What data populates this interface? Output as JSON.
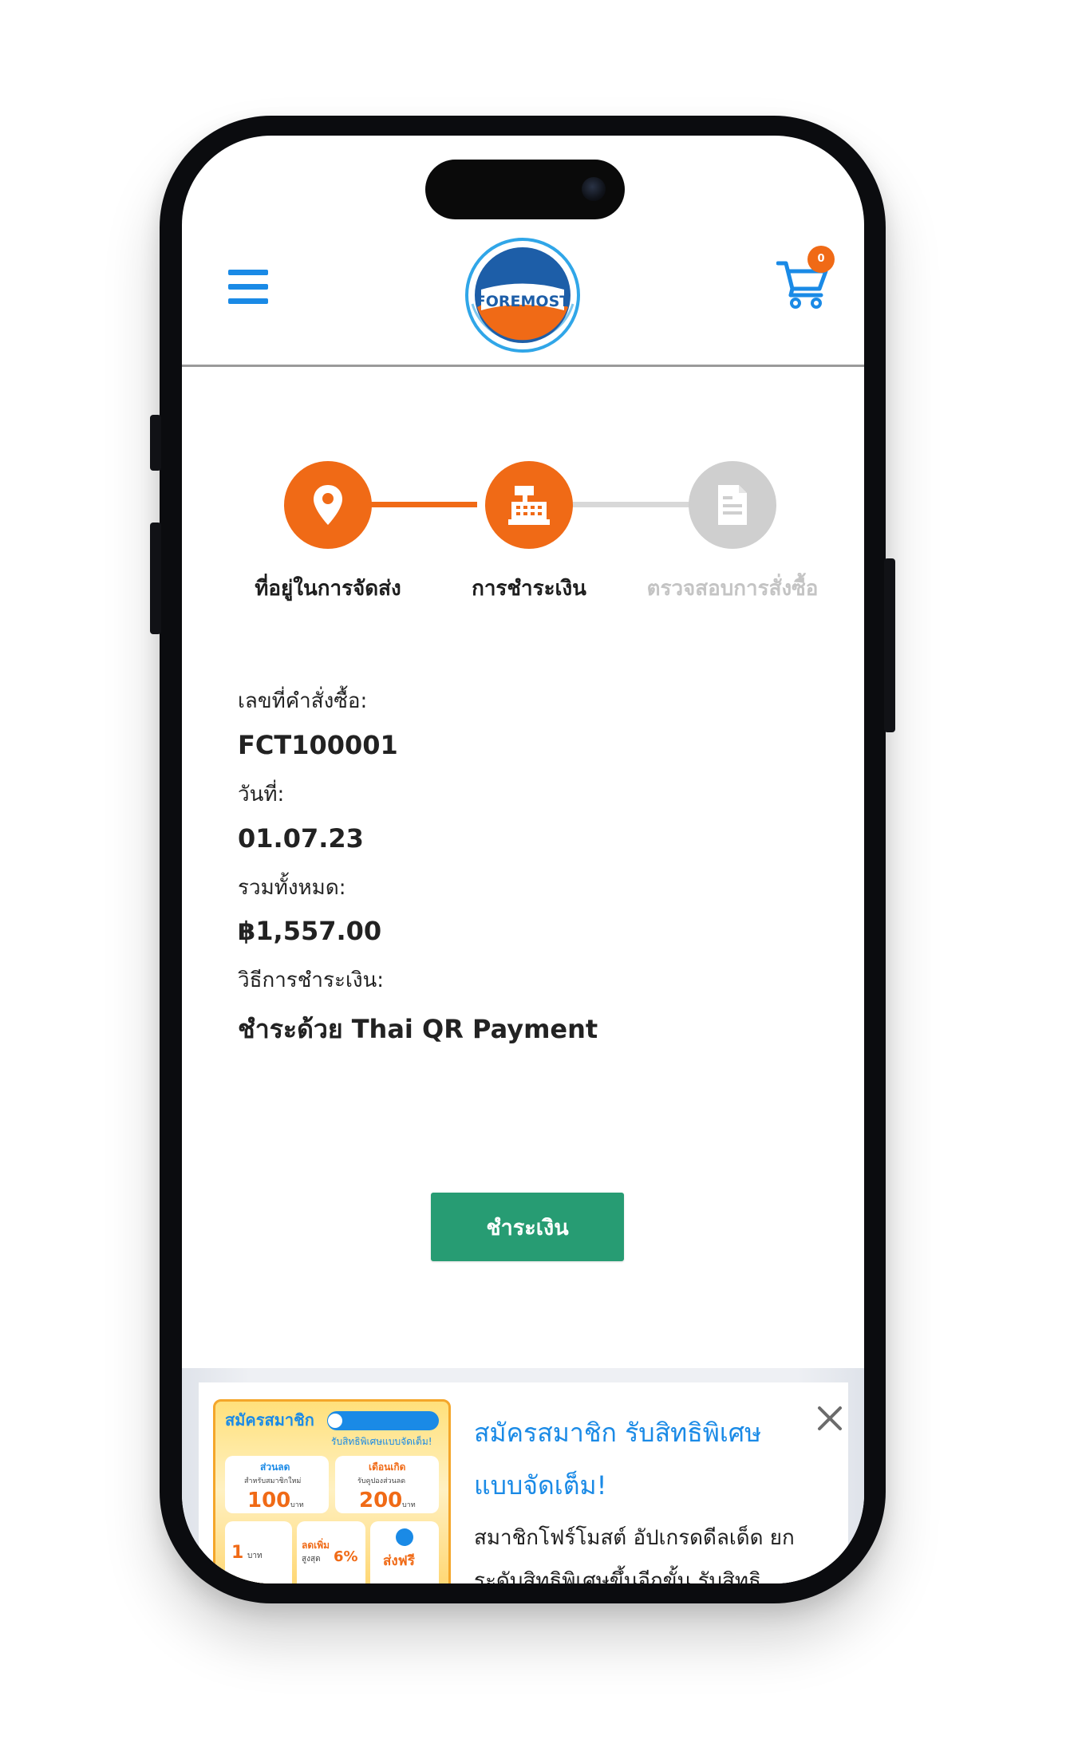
{
  "header": {
    "logo_text": "FOREMOST",
    "cart_count": "0"
  },
  "steps": [
    {
      "label": "ที่อยู่ในการจัดส่ง",
      "state": "completed"
    },
    {
      "label": "การชำระเงิน",
      "state": "active"
    },
    {
      "label": "ตรวจสอบการสั่งซื้อ",
      "state": "pending"
    }
  ],
  "order": {
    "number_label": "เลขที่คำสั่งซื้อ:",
    "number_value": "FCT100001",
    "date_label": "วันที่:",
    "date_value": "01.07.23",
    "total_label": "รวมทั้งหมด:",
    "total_value": "฿1,557.00",
    "method_label": "วิธีการชำระเงิน:",
    "method_value": "ชำระด้วย Thai QR Payment"
  },
  "pay_button_label": "ชำระเงิน",
  "promo": {
    "title": "สมัครสมาชิก รับสิทธิพิเศษแบบจัดเต็ม!",
    "body": "สมาชิกโฟร์โมสต์ อัปเกรดดีลเด็ด ยกระดับสิทธิพิเศษขึ้นอีกขั้น รับสิทธิประโยชน์แบบจัด",
    "image": {
      "headline": "สมัครสมาชิก",
      "subheadline": "รับสิทธิพิเศษแบบจัดเต็ม!",
      "tile1_title": "ส่วนลด",
      "tile1_sub": "สำหรับสมาชิกใหม่",
      "tile1_value": "100",
      "tile1_unit": "บาท",
      "tile2_title": "เดือนเกิด",
      "tile2_sub": "รับคูปองส่วนลด",
      "tile2_value": "200",
      "tile2_unit": "บาท",
      "tile3_value": "1",
      "tile3_unit": "บาท",
      "tile4_title": "ลดเพิ่ม",
      "tile4_sub": "สูงสุด",
      "tile4_value": "6%",
      "tile5_title": "ส่งฟรี"
    }
  },
  "colors": {
    "brand_blue": "#1a8ae6",
    "step_orange": "#f06a16",
    "step_gray": "#cfcfcf",
    "pay_green": "#279c73"
  }
}
